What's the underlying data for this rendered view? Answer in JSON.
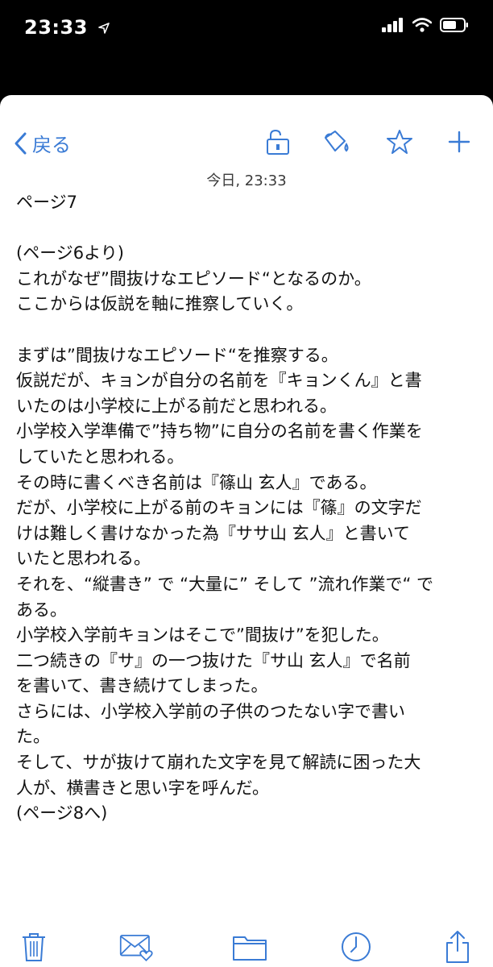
{
  "status_bar": {
    "time": "23:33"
  },
  "navbar": {
    "back_label": "戻る"
  },
  "message": {
    "date": "今日, 23:33",
    "lines": [
      "ページ7",
      "",
      "(ページ6より)",
      "これがなぜ”間抜けなエピソード“となるのか。",
      "ここからは仮説を軸に推察していく。",
      "",
      "まずは”間抜けなエピソード“を推察する。",
      "仮説だが、キョンが自分の名前を『キョンくん』と書",
      "いたのは小学校に上がる前だと思われる。",
      "小学校入学準備で”持ち物”に自分の名前を書く作業を",
      "していたと思われる。",
      "その時に書くべき名前は『篠山 玄人』である。",
      "だが、小学校に上がる前のキョンには『篠』の文字だ",
      "けは難しく書けなかった為『ササ山 玄人』と書いて",
      "いたと思われる。",
      "それを、“縦書き” で “大量に” そして ”流れ作業で“ で",
      "ある。",
      "小学校入学前キョンはそこで”間抜け”を犯した。",
      "二つ続きの『サ』の一つ抜けた『サ山 玄人』で名前",
      "を書いて、書き続けてしまった。",
      "さらには、小学校入学前の子供のつたない字で書い",
      "た。",
      "そして、サが抜けて崩れた文字を見て解読に困った大",
      "人が、横書きと思い字を呼んだ。",
      "(ページ8へ)"
    ]
  },
  "icons": {
    "accent_color": "#3a7bd5",
    "nav": [
      "chevron-left-icon",
      "unlock-icon",
      "paint-bucket-icon",
      "star-icon",
      "plus-icon"
    ],
    "toolbar": [
      "trash-icon",
      "mail-heart-icon",
      "folder-icon",
      "clock-icon",
      "share-icon"
    ]
  }
}
